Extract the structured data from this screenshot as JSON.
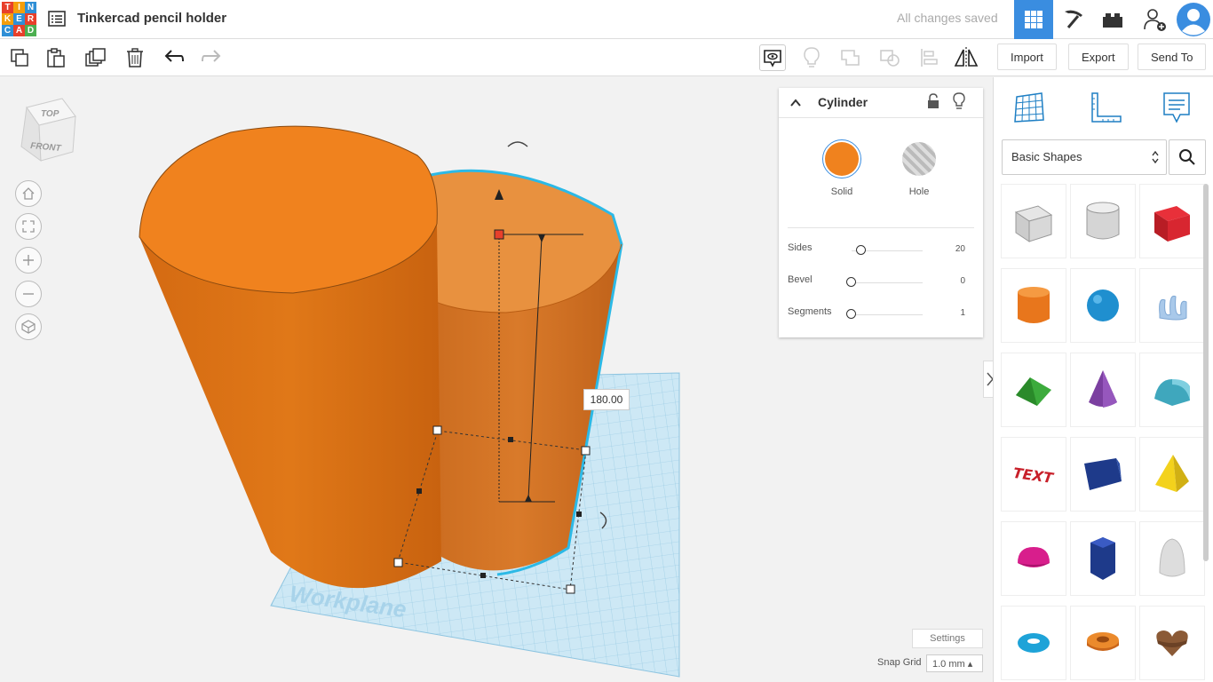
{
  "app": {
    "logo_letters": [
      "T",
      "I",
      "N",
      "K",
      "E",
      "R",
      "C",
      "A",
      "D"
    ],
    "title": "Tinkercad pencil holder",
    "status": "All changes saved"
  },
  "toolbar": {
    "import_label": "Import",
    "export_label": "Export",
    "send_to_label": "Send To"
  },
  "navcube": {
    "top": "TOP",
    "front": "FRONT"
  },
  "workplane_label": "Workplane",
  "dimension_value": "180.00",
  "inspector": {
    "shape_name": "Cylinder",
    "solid_label": "Solid",
    "hole_label": "Hole",
    "solid_color": "#f0821e",
    "props": [
      {
        "label": "Sides",
        "value": "20",
        "level": 0.15
      },
      {
        "label": "Bevel",
        "value": "0",
        "level": 0.0
      },
      {
        "label": "Segments",
        "value": "1",
        "level": 0.0
      }
    ]
  },
  "library": {
    "category": "Basic Shapes",
    "shapes": [
      "Box Hole",
      "Cylinder Hole",
      "Box",
      "Cylinder",
      "Sphere",
      "Scribble",
      "Roof",
      "Cone",
      "Round Roof",
      "Text",
      "Wedge",
      "Pyramid",
      "Half Sphere",
      "Polygon",
      "Paraboloid",
      "Torus",
      "Tube",
      "Heart"
    ]
  },
  "footer": {
    "settings_label": "Settings",
    "snap_label": "Snap Grid",
    "snap_value": "1.0 mm ▴"
  },
  "colors": {
    "accent": "#3a8de0",
    "orange": "#f0821e",
    "selection": "#2cb9e6"
  }
}
